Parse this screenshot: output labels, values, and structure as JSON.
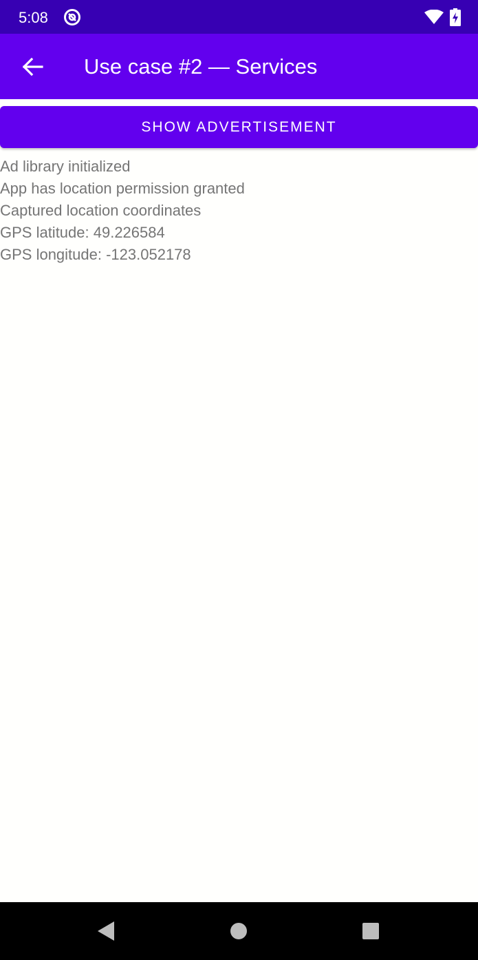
{
  "status_bar": {
    "time": "5:08",
    "icons": [
      "at-sign-icon",
      "wifi-icon",
      "battery-charging-icon"
    ]
  },
  "app_bar": {
    "title": "Use case #2 — Services",
    "back_icon": "arrow-back-icon",
    "background": "#6200ee"
  },
  "ad_button": {
    "label": "SHOW ADVERTISEMENT",
    "background": "#6200ee"
  },
  "log": {
    "lines": [
      "Ad library initialized",
      "App has location permission granted",
      "Captured location coordinates",
      "GPS latitude: 49.226584",
      "GPS longitude: -123.052178"
    ]
  },
  "nav_bar": {
    "icons": [
      "back-triangle-icon",
      "home-circle-icon",
      "recents-square-icon"
    ]
  },
  "colors": {
    "status_bar": "#3700b3",
    "accent": "#6200ee",
    "log_text": "#757575"
  }
}
